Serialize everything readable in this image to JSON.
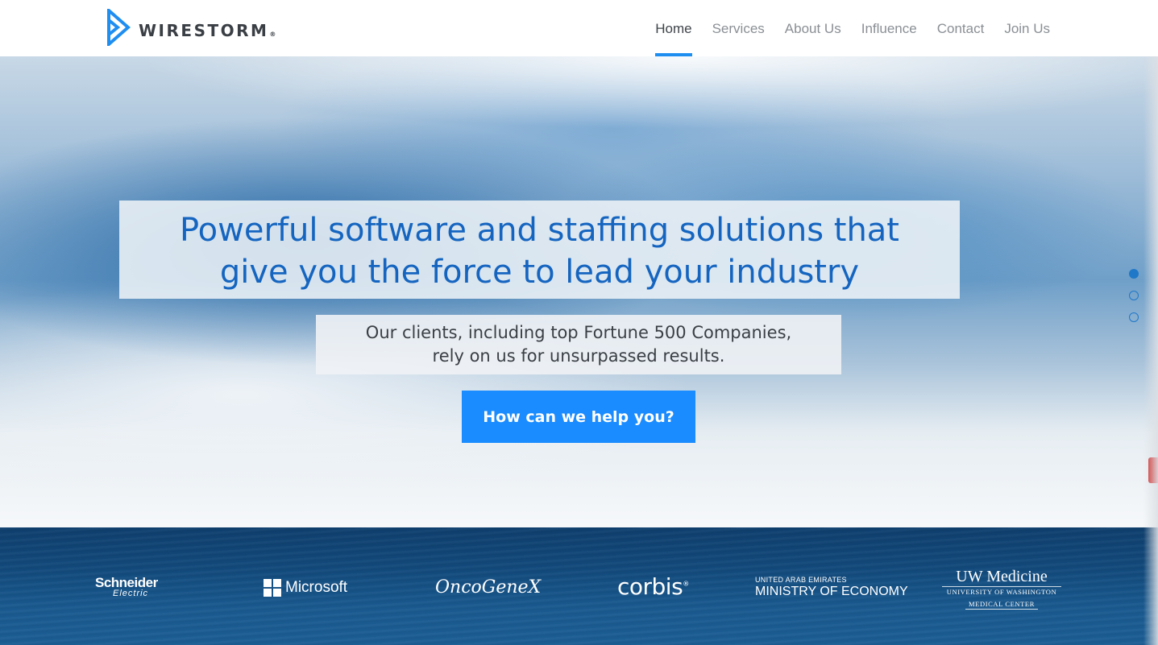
{
  "brand": {
    "name": "WIRESTORM",
    "reg": "®",
    "accent": "#1f8ef1"
  },
  "nav": {
    "items": [
      {
        "label": "Home",
        "active": true
      },
      {
        "label": "Services"
      },
      {
        "label": "About Us"
      },
      {
        "label": "Influence"
      },
      {
        "label": "Contact"
      },
      {
        "label": "Join Us"
      }
    ]
  },
  "hero": {
    "headline_line1": "Powerful software and staffing solutions that",
    "headline_line2": "give you the force to lead your industry",
    "sub_line1": "Our clients, including top Fortune 500 Companies,",
    "sub_line2": "rely on us for unsurpassed results.",
    "cta": "How can we help you?",
    "slides": {
      "count": 3,
      "active": 1
    }
  },
  "clients": {
    "schneider": {
      "line1": "Schneider",
      "line2": "Electric"
    },
    "microsoft": "Microsoft",
    "oncogenex": "OncoGeneX",
    "corbis": {
      "name": "corbis",
      "mark": "®"
    },
    "uae": {
      "line1": "UNITED ARAB EMIRATES",
      "line2": "MINISTRY OF ECONOMY"
    },
    "uw": {
      "line1": "UW Medicine",
      "line2": "UNIVERSITY OF WASHINGTON",
      "line3": "MEDICAL CENTER"
    }
  }
}
